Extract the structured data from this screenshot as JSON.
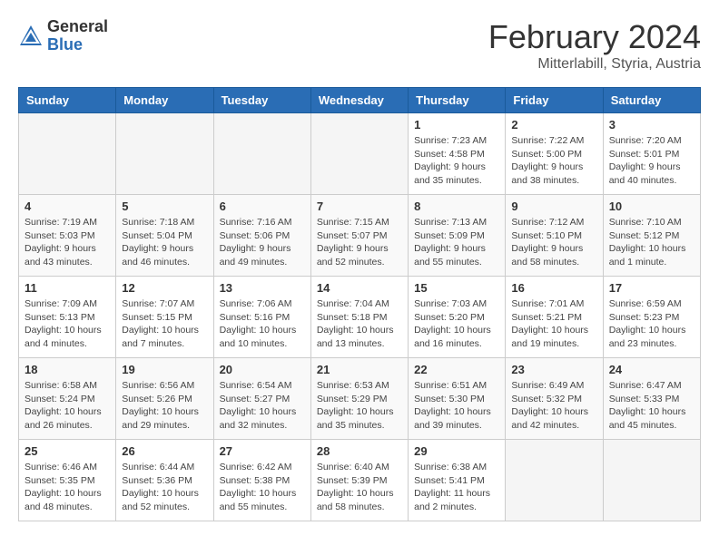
{
  "header": {
    "logo_general": "General",
    "logo_blue": "Blue",
    "title": "February 2024",
    "subtitle": "Mitterlabill, Styria, Austria"
  },
  "days_of_week": [
    "Sunday",
    "Monday",
    "Tuesday",
    "Wednesday",
    "Thursday",
    "Friday",
    "Saturday"
  ],
  "weeks": [
    {
      "days": [
        {
          "num": "",
          "info": "",
          "empty": true
        },
        {
          "num": "",
          "info": "",
          "empty": true
        },
        {
          "num": "",
          "info": "",
          "empty": true
        },
        {
          "num": "",
          "info": "",
          "empty": true
        },
        {
          "num": "1",
          "info": "Sunrise: 7:23 AM\nSunset: 4:58 PM\nDaylight: 9 hours\nand 35 minutes."
        },
        {
          "num": "2",
          "info": "Sunrise: 7:22 AM\nSunset: 5:00 PM\nDaylight: 9 hours\nand 38 minutes."
        },
        {
          "num": "3",
          "info": "Sunrise: 7:20 AM\nSunset: 5:01 PM\nDaylight: 9 hours\nand 40 minutes."
        }
      ]
    },
    {
      "days": [
        {
          "num": "4",
          "info": "Sunrise: 7:19 AM\nSunset: 5:03 PM\nDaylight: 9 hours\nand 43 minutes."
        },
        {
          "num": "5",
          "info": "Sunrise: 7:18 AM\nSunset: 5:04 PM\nDaylight: 9 hours\nand 46 minutes."
        },
        {
          "num": "6",
          "info": "Sunrise: 7:16 AM\nSunset: 5:06 PM\nDaylight: 9 hours\nand 49 minutes."
        },
        {
          "num": "7",
          "info": "Sunrise: 7:15 AM\nSunset: 5:07 PM\nDaylight: 9 hours\nand 52 minutes."
        },
        {
          "num": "8",
          "info": "Sunrise: 7:13 AM\nSunset: 5:09 PM\nDaylight: 9 hours\nand 55 minutes."
        },
        {
          "num": "9",
          "info": "Sunrise: 7:12 AM\nSunset: 5:10 PM\nDaylight: 9 hours\nand 58 minutes."
        },
        {
          "num": "10",
          "info": "Sunrise: 7:10 AM\nSunset: 5:12 PM\nDaylight: 10 hours\nand 1 minute."
        }
      ]
    },
    {
      "days": [
        {
          "num": "11",
          "info": "Sunrise: 7:09 AM\nSunset: 5:13 PM\nDaylight: 10 hours\nand 4 minutes."
        },
        {
          "num": "12",
          "info": "Sunrise: 7:07 AM\nSunset: 5:15 PM\nDaylight: 10 hours\nand 7 minutes."
        },
        {
          "num": "13",
          "info": "Sunrise: 7:06 AM\nSunset: 5:16 PM\nDaylight: 10 hours\nand 10 minutes."
        },
        {
          "num": "14",
          "info": "Sunrise: 7:04 AM\nSunset: 5:18 PM\nDaylight: 10 hours\nand 13 minutes."
        },
        {
          "num": "15",
          "info": "Sunrise: 7:03 AM\nSunset: 5:20 PM\nDaylight: 10 hours\nand 16 minutes."
        },
        {
          "num": "16",
          "info": "Sunrise: 7:01 AM\nSunset: 5:21 PM\nDaylight: 10 hours\nand 19 minutes."
        },
        {
          "num": "17",
          "info": "Sunrise: 6:59 AM\nSunset: 5:23 PM\nDaylight: 10 hours\nand 23 minutes."
        }
      ]
    },
    {
      "days": [
        {
          "num": "18",
          "info": "Sunrise: 6:58 AM\nSunset: 5:24 PM\nDaylight: 10 hours\nand 26 minutes."
        },
        {
          "num": "19",
          "info": "Sunrise: 6:56 AM\nSunset: 5:26 PM\nDaylight: 10 hours\nand 29 minutes."
        },
        {
          "num": "20",
          "info": "Sunrise: 6:54 AM\nSunset: 5:27 PM\nDaylight: 10 hours\nand 32 minutes."
        },
        {
          "num": "21",
          "info": "Sunrise: 6:53 AM\nSunset: 5:29 PM\nDaylight: 10 hours\nand 35 minutes."
        },
        {
          "num": "22",
          "info": "Sunrise: 6:51 AM\nSunset: 5:30 PM\nDaylight: 10 hours\nand 39 minutes."
        },
        {
          "num": "23",
          "info": "Sunrise: 6:49 AM\nSunset: 5:32 PM\nDaylight: 10 hours\nand 42 minutes."
        },
        {
          "num": "24",
          "info": "Sunrise: 6:47 AM\nSunset: 5:33 PM\nDaylight: 10 hours\nand 45 minutes."
        }
      ]
    },
    {
      "days": [
        {
          "num": "25",
          "info": "Sunrise: 6:46 AM\nSunset: 5:35 PM\nDaylight: 10 hours\nand 48 minutes."
        },
        {
          "num": "26",
          "info": "Sunrise: 6:44 AM\nSunset: 5:36 PM\nDaylight: 10 hours\nand 52 minutes."
        },
        {
          "num": "27",
          "info": "Sunrise: 6:42 AM\nSunset: 5:38 PM\nDaylight: 10 hours\nand 55 minutes."
        },
        {
          "num": "28",
          "info": "Sunrise: 6:40 AM\nSunset: 5:39 PM\nDaylight: 10 hours\nand 58 minutes."
        },
        {
          "num": "29",
          "info": "Sunrise: 6:38 AM\nSunset: 5:41 PM\nDaylight: 11 hours\nand 2 minutes."
        },
        {
          "num": "",
          "info": "",
          "empty": true
        },
        {
          "num": "",
          "info": "",
          "empty": true
        }
      ]
    }
  ]
}
